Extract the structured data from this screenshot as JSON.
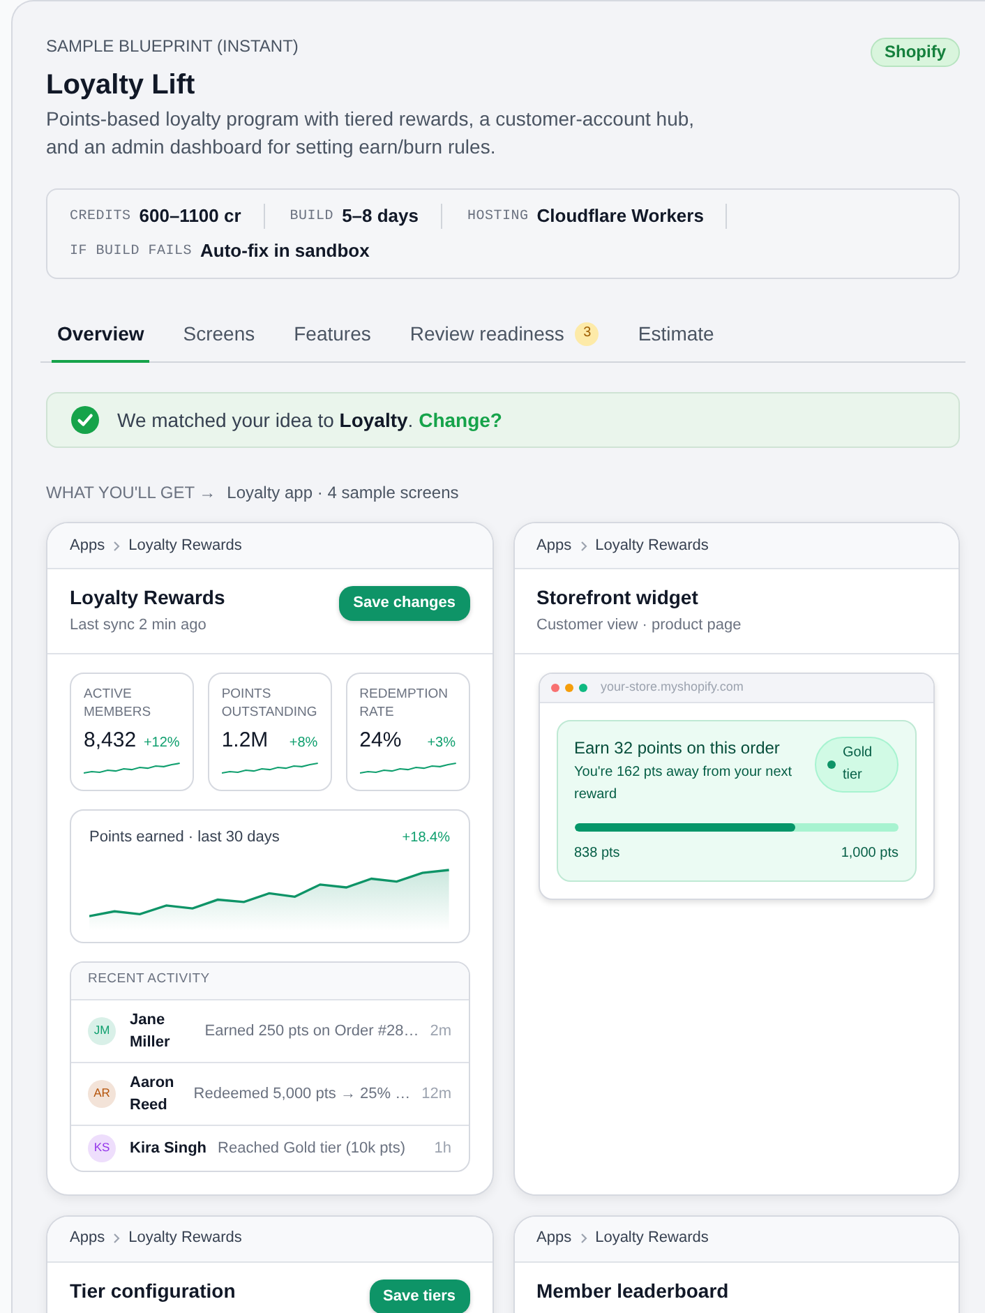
{
  "header": {
    "eyebrow": "SAMPLE BLUEPRINT (INSTANT)",
    "title": "Loyalty Lift",
    "description": "Points-based loyalty program with tiered rewards, a customer-account hub, and an admin dashboard for setting earn/burn rules.",
    "platform_badge": "Shopify"
  },
  "meta": [
    {
      "label": "CREDITS",
      "value": "600–1100 cr"
    },
    {
      "label": "BUILD",
      "value": "5–8 days"
    },
    {
      "label": "HOSTING",
      "value": "Cloudflare Workers"
    },
    {
      "label": "IF BUILD FAILS",
      "value": "Auto-fix in sandbox"
    }
  ],
  "tabs": [
    {
      "label": "Overview",
      "selected": true
    },
    {
      "label": "Screens",
      "selected": false
    },
    {
      "label": "Features",
      "selected": false
    },
    {
      "label": "Review readiness",
      "selected": false,
      "badge": "3"
    },
    {
      "label": "Estimate",
      "selected": false
    }
  ],
  "match_banner": {
    "text": "We matched your idea to **Loyalty**.",
    "link": "Change?"
  },
  "section_heading": {
    "title": "WHAT YOU'LL GET →",
    "subtitle": "Loyalty app · 4 sample screens"
  },
  "screens": [
    {
      "kind": "dashboard",
      "breadcrumb": [
        "Apps",
        "Loyalty Rewards"
      ],
      "title": "Loyalty Rewards",
      "subtitle": "Last sync 2 min ago",
      "button": "Save changes",
      "stats": [
        {
          "label": "ACTIVE MEMBERS",
          "value": "8,432",
          "change": "+12%"
        },
        {
          "label": "POINTS OUTSTANDING",
          "value": "1.2M",
          "change": "+8%"
        },
        {
          "label": "REDEMPTION RATE",
          "value": "24%",
          "change": "+3%"
        }
      ],
      "chart": {
        "title": "Points earned · last 30 days",
        "change": "+18.4%"
      },
      "activity": {
        "heading": "RECENT ACTIVITY",
        "rows": [
          {
            "initials": "JM",
            "color": "#0f9f6e",
            "name": "Jane Miller",
            "event": "Earned 250 pts on Order #28…",
            "time": "2m"
          },
          {
            "initials": "AR",
            "color": "#b45309",
            "name": "Aaron Reed",
            "event": "Redeemed 5,000 pts → 25% …",
            "time": "12m"
          },
          {
            "initials": "KS",
            "color": "#9333ea",
            "name": "Kira Singh",
            "event": "Reached Gold tier (10k pts)",
            "time": "1h"
          }
        ]
      }
    },
    {
      "kind": "widget",
      "breadcrumb": [
        "Apps",
        "Loyalty Rewards"
      ],
      "title": "Storefront widget",
      "subtitle": "Customer view · product page",
      "browser": {
        "url": "your-store.myshopify.com"
      },
      "offer": {
        "title": "Earn 32 points on this order",
        "note": "You're 162 pts away from your next reward",
        "tier": "Gold tier",
        "level": 0.68,
        "start": "838 pts",
        "end": "1,000 pts"
      }
    },
    {
      "kind": "tiers",
      "breadcrumb": [
        "Apps",
        "Loyalty Rewards"
      ],
      "title": "Tier configuration",
      "button": "Save tiers"
    },
    {
      "kind": "leaderboard",
      "breadcrumb": [
        "Apps",
        "Loyalty Rewards"
      ],
      "title": "Member leaderboard"
    }
  ]
}
